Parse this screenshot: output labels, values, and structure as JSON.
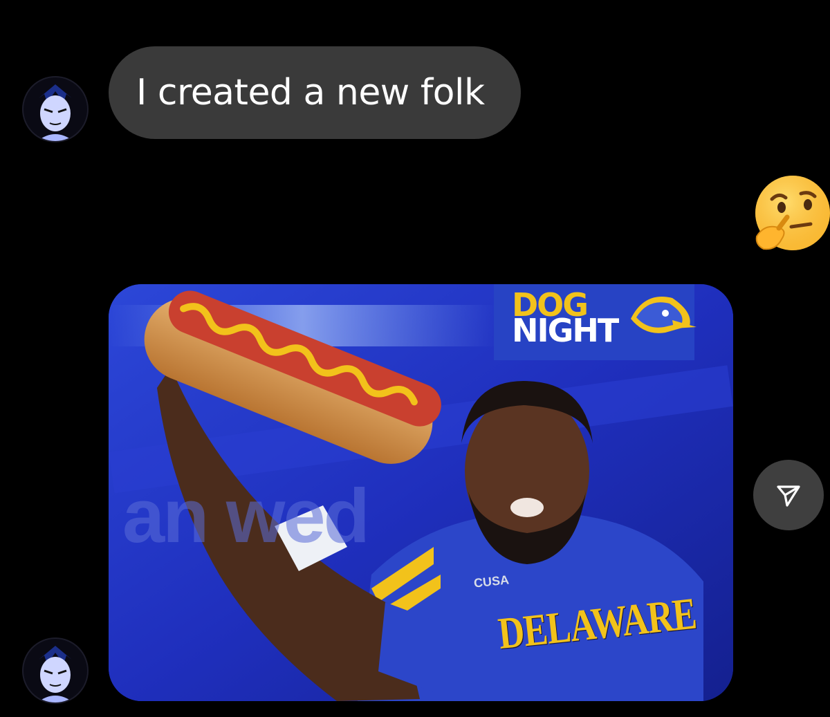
{
  "messages": [
    {
      "type": "text",
      "text": "I created a new folk"
    },
    {
      "type": "image"
    }
  ],
  "reaction": {
    "emoji": "🤔",
    "icon": "thinking-face-icon"
  },
  "share": {
    "icon": "send-icon"
  },
  "photo": {
    "banner_line_1": "DOG",
    "banner_line_2": "NIGHT",
    "wall_text": "an wed",
    "jersey_text": "DELAWARE",
    "patch_text": "CUSA"
  },
  "colors": {
    "background": "#000000",
    "bubble": "#3a3a3a",
    "bubble_text": "#ffffff",
    "share_button": "#3f3f3f",
    "photo_blue": "#1f2fbd",
    "gold": "#f2c21b"
  }
}
